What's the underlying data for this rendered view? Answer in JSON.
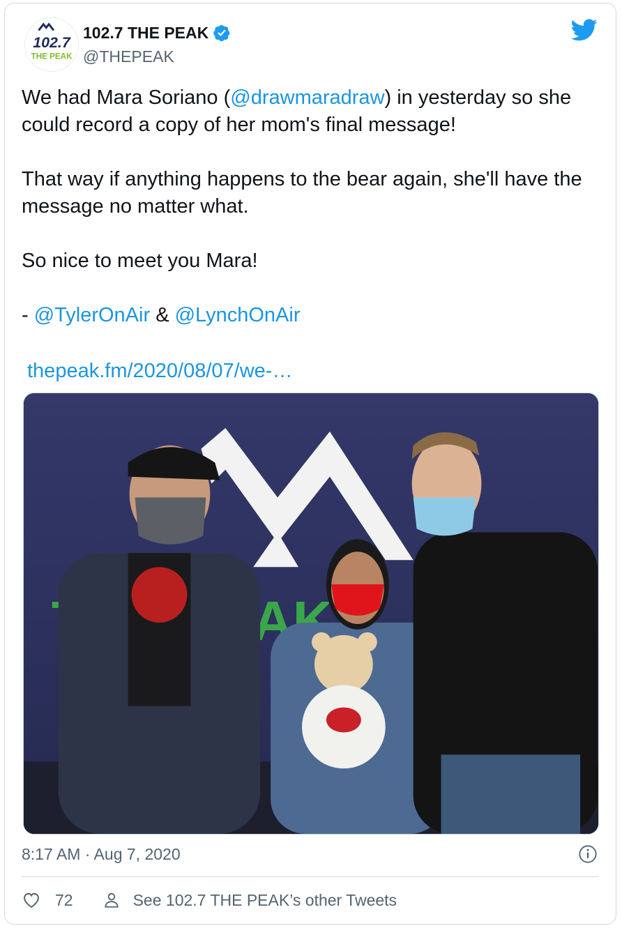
{
  "author": {
    "display_name": "102.7 THE PEAK",
    "handle": "@THEPEAK",
    "avatar_text_top": "102.7",
    "avatar_text_bottom": "THE PEAK",
    "verified": true
  },
  "tweet": {
    "line1_pre": "We had Mara Soriano (",
    "mention1": "@drawmaradraw",
    "line1_post": ") in yesterday so she could record a copy of her mom's final message!",
    "paragraph2": "That way if anything happens to the bear again, she'll have the message no matter what.",
    "paragraph3": "So nice to meet you Mara!",
    "sign_prefix": "- ",
    "mention2": "@TylerOnAir",
    "sign_amp": " & ",
    "mention3": "@LynchOnAir",
    "url": "thepeak.fm/2020/08/07/we-…"
  },
  "photo": {
    "backdrop_text": "THE PEAK"
  },
  "meta": {
    "timestamp": "8:17 AM · Aug 7, 2020"
  },
  "actions": {
    "like_count": "72",
    "other_tweets_label": "See 102.7 THE PEAK’s other Tweets"
  },
  "colors": {
    "link": "#1b95e0",
    "verified": "#1d9bf0",
    "twitter_brand": "#1d9bf0",
    "muted_text": "#536471"
  },
  "icons": [
    "verified-icon",
    "twitter-icon",
    "info-icon",
    "heart-icon",
    "person-icon"
  ]
}
